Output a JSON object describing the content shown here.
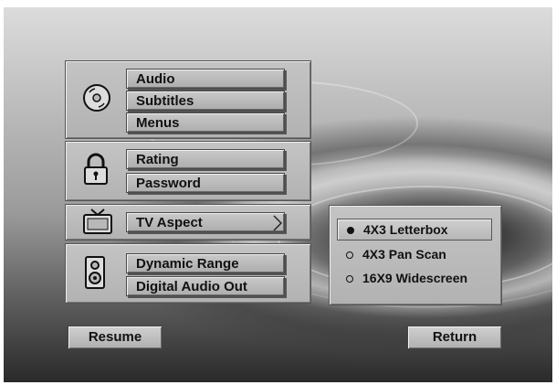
{
  "menu": {
    "disc_group": {
      "items": [
        {
          "label": "Audio"
        },
        {
          "label": "Subtitles"
        },
        {
          "label": "Menus"
        }
      ]
    },
    "lock_group": {
      "items": [
        {
          "label": "Rating"
        },
        {
          "label": "Password"
        }
      ]
    },
    "tv_group": {
      "items": [
        {
          "label": "TV Aspect"
        }
      ]
    },
    "speaker_group": {
      "items": [
        {
          "label": "Dynamic Range"
        },
        {
          "label": "Digital Audio Out"
        }
      ]
    }
  },
  "tv_aspect_options": {
    "selected": "4X3 Letterbox",
    "options": [
      {
        "label": "4X3 Letterbox"
      },
      {
        "label": "4X3 Pan Scan"
      },
      {
        "label": "16X9 Widescreen"
      }
    ]
  },
  "footer": {
    "resume_label": "Resume",
    "return_label": "Return"
  },
  "icons": {
    "disc": "disc-icon",
    "lock": "lock-icon",
    "tv": "tv-icon",
    "speaker": "speaker-icon",
    "arrow": "chevron-right-icon"
  }
}
